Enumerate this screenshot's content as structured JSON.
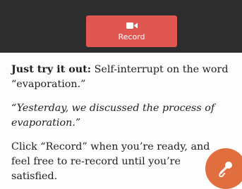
{
  "record_button": {
    "label": "Record",
    "icon": "video-camera-icon"
  },
  "instructions": {
    "lead": "Just try it out:",
    "line1_rest": " Self-interrupt on the word",
    "line2": "“evaporation.”",
    "quote_line1": "“Yesterday, we discussed the process of",
    "quote_line2": "evaporation.”",
    "p3_line1": "Click “Record” when you’re ready, and",
    "p3_line2": "feel free to re-record until you’re",
    "p3_line3": "satisfied."
  },
  "fab": {
    "icon": "microphone-icon"
  },
  "colors": {
    "topbar": "#2d2d2d",
    "record": "#e05651",
    "fab": "#e16e3f"
  }
}
